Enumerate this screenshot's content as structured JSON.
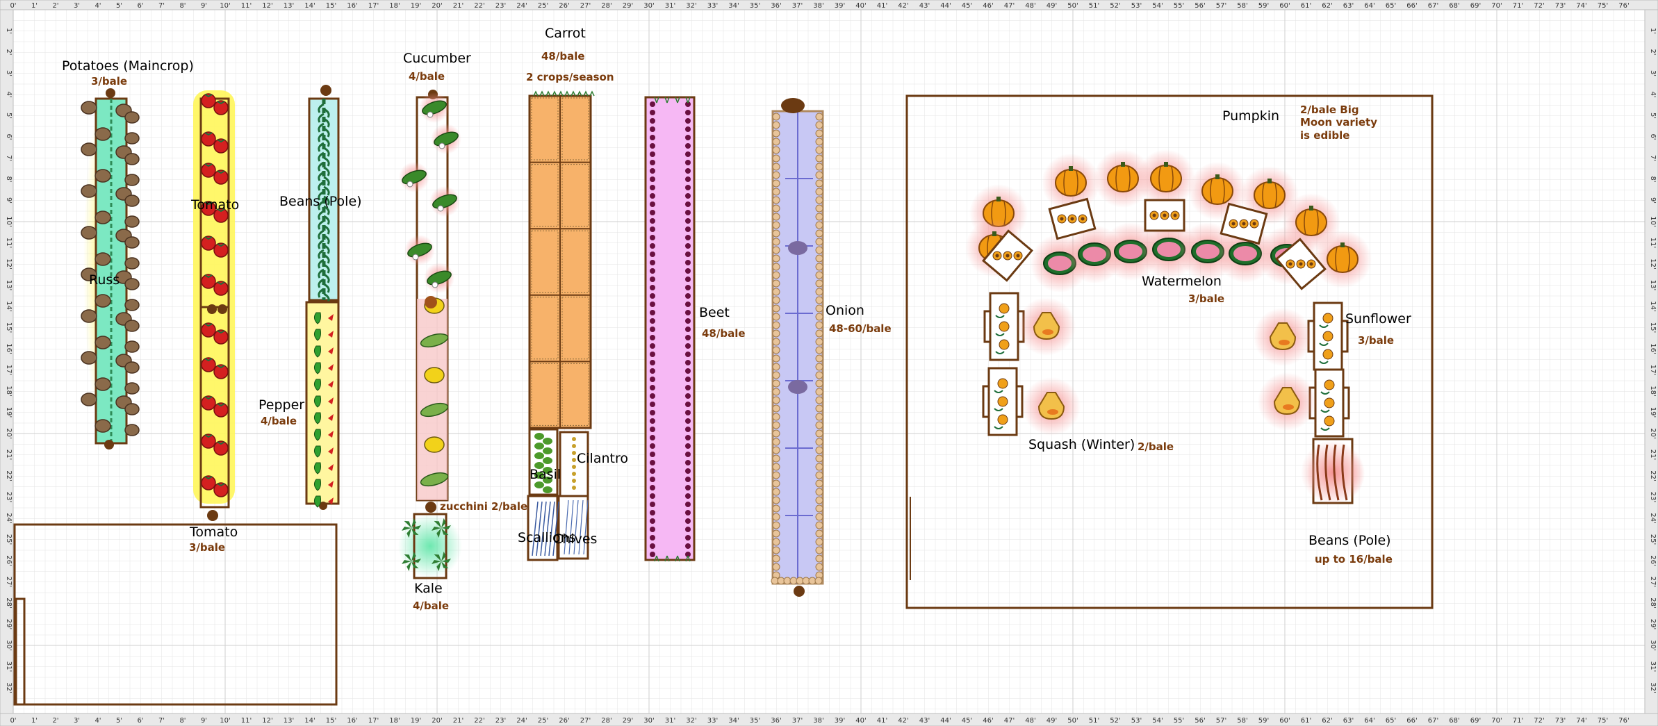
{
  "ruler": {
    "top_labels": [
      "0'",
      "1'",
      "2'",
      "3'",
      "4'",
      "5'",
      "6'",
      "7'",
      "8'",
      "9'",
      "10'",
      "11'",
      "12'",
      "13'",
      "14'",
      "15'",
      "16'",
      "17'",
      "18'",
      "19'",
      "20'",
      "21'",
      "22'",
      "23'",
      "24'",
      "25'",
      "26'",
      "27'",
      "28'",
      "29'",
      "30'",
      "31'",
      "32'",
      "33'",
      "34'",
      "35'",
      "36'",
      "37'",
      "38'",
      "39'",
      "40'",
      "41'",
      "42'",
      "43'",
      "44'",
      "45'",
      "46'",
      "47'",
      "48'",
      "49'",
      "50'",
      "51'",
      "52'",
      "53'",
      "54'",
      "55'",
      "56'",
      "57'",
      "58'",
      "59'",
      "60'",
      "61'",
      "62'",
      "63'",
      "64'",
      "65'",
      "66'",
      "67'",
      "68'",
      "69'",
      "70'",
      "71'",
      "72'",
      "73'",
      "74'",
      "75'",
      "76'"
    ],
    "side_labels": [
      "1'",
      "2'",
      "3'",
      "4'",
      "5'",
      "6'",
      "7'",
      "8'",
      "9'",
      "10'",
      "11'",
      "12'",
      "13'",
      "14'",
      "15'",
      "16'",
      "17'",
      "18'",
      "19'",
      "20'",
      "21'",
      "22'",
      "23'",
      "24'",
      "25'",
      "26'",
      "27'",
      "28'",
      "29'",
      "30'",
      "31'",
      "32'"
    ]
  },
  "labels": {
    "potatoes": "Potatoes (Maincrop)",
    "potatoes_note": "3/bale",
    "russet_partial": "Russ",
    "tomato_upper": "Tomato",
    "tomato_lower": "Tomato",
    "tomato_lower_note": "3/bale",
    "beans_pole_left": "Beans (Pole)",
    "pepper": "Pepper",
    "pepper_note": "4/bale",
    "cucumber": "Cucumber",
    "cucumber_note": "4/bale",
    "zucchini_note": "zucchini 2/bale",
    "kale": "Kale",
    "kale_note": "4/bale",
    "carrot": "Carrot",
    "carrot_note1": "48/bale",
    "carrot_note2": "2 crops/season",
    "basil": "Basil",
    "cilantro": "Cilantro",
    "scallions": "Scallions",
    "chives": "Chives",
    "beet": "Beet",
    "beet_note": "48/bale",
    "onion": "Onion",
    "onion_note": "48-60/bale",
    "pumpkin": "Pumpkin",
    "pumpkin_note1": "2/bale  Big",
    "pumpkin_note2": "Moon variety",
    "pumpkin_note3": "is edible",
    "watermelon": "Watermelon",
    "watermelon_note": "3/bale",
    "sunflower": "Sunflower",
    "sunflower_note": "3/bale",
    "squash_winter": "Squash (Winter)",
    "squash_winter_note": "2/bale",
    "beans_pole_right": "Beans (Pole)",
    "beans_pole_right_note": "up to 16/bale"
  },
  "colors": {
    "frame": "#6b3a12",
    "potato": "#8a6a4a",
    "tomato": "#d42020",
    "tomato_glow": "#fff34a",
    "carrot_bed": "#f7b26a",
    "beet_bed": "#f6b8f4",
    "onion_bed": "#c8c8f4",
    "pumpkin": "#f29a12",
    "melon_glow": "#f8a0a0",
    "leaf": "#1e6e3a"
  }
}
